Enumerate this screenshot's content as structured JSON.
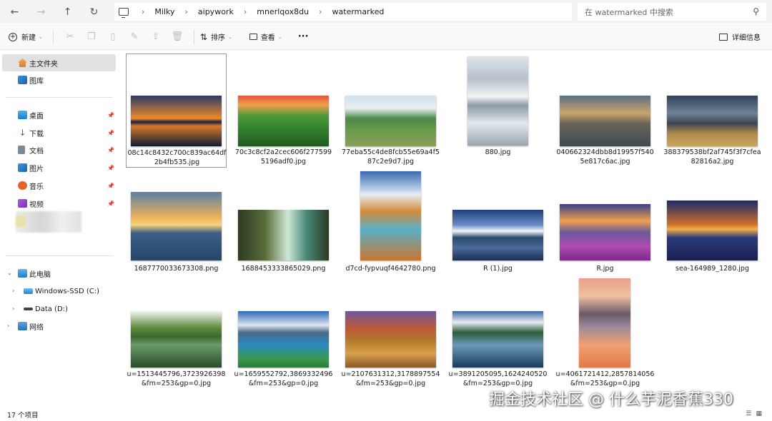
{
  "nav": {
    "back": "←",
    "forward": "→",
    "up": "↑",
    "refresh": "↻"
  },
  "breadcrumb": [
    "Milky",
    "aipywork",
    "mnerlqox8du",
    "watermarked"
  ],
  "search": {
    "placeholder": "在 watermarked 中搜索"
  },
  "toolbar": {
    "new_label": "新建",
    "sort_label": "排序",
    "view_label": "查看",
    "more": "···",
    "details_label": "详细信息"
  },
  "sidebar": {
    "home": "主文件夹",
    "gallery": "图库",
    "quick": [
      "桌面",
      "下载",
      "文档",
      "图片",
      "音乐",
      "视频"
    ],
    "this_pc": "此电脑",
    "drives": [
      "Windows-SSD (C:)",
      "Data (D:)"
    ],
    "network": "网络"
  },
  "files": [
    "08c14c8432c700c839ac64df2b4fb535.jpg",
    "70c3c8cf2a2cec606f2775995196adf0.jpg",
    "77eba55c4de8fcb55e69a4f587c2e9d7.jpg",
    "880.jpg",
    "040662324dbb8d19957f5405e817c6ac.jpg",
    "388379538bf2af745f3f7cfea82816a2.jpg",
    "1687770033673308.png",
    "1688453333865029.png",
    "d7cd-fypvuqf4642780.png",
    "R (1).jpg",
    "R.jpg",
    "sea-164989_1280.jpg",
    "u=1513445796,3723926398&fm=253&gp=0.jpg",
    "u=1659552792,3869332496&fm=253&gp=0.jpg",
    "u=2107631312,3178897554&fm=253&gp=0.jpg",
    "u=3891205095,1624240520&fm=253&gp=0.jpg",
    "u=4061721412,2857814056&fm=253&gp=0.jpg"
  ],
  "status": {
    "count": "17 个项目"
  },
  "watermark": "掘金技术社区 @ 什么芋泥香蕉330"
}
